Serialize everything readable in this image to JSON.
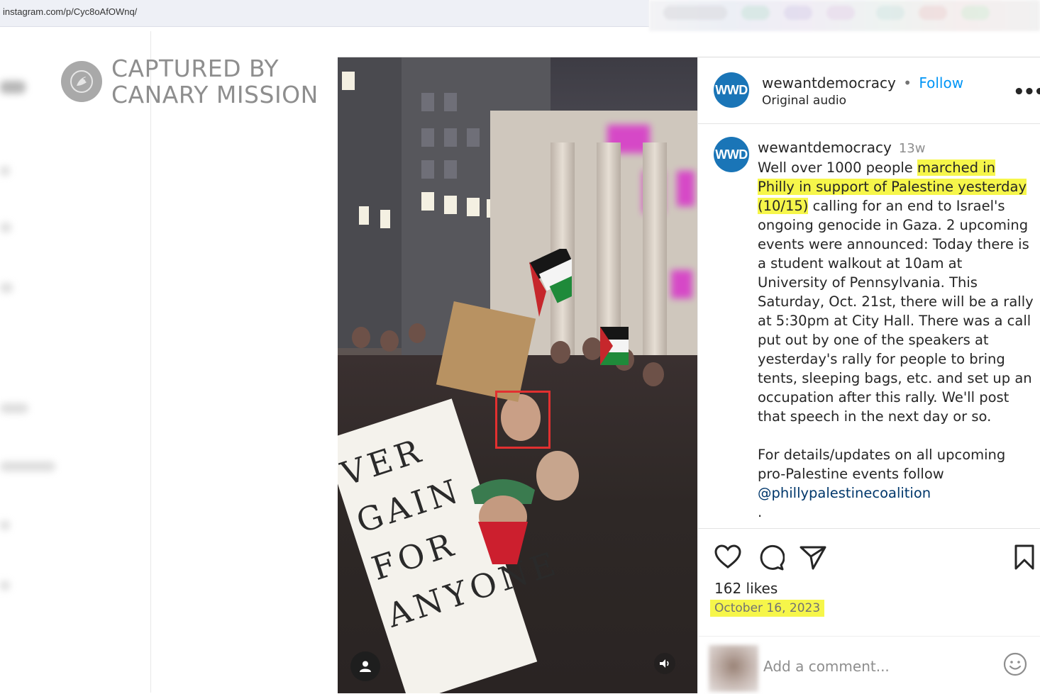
{
  "browser": {
    "url": "instagram.com/p/Cyc8oAfOWnq/"
  },
  "watermark": {
    "line1": "CAPTURED BY",
    "line2": "CANARY MISSION",
    "icon": "canary-bird-icon"
  },
  "media": {
    "sign_text": "VER\nGAIN\nFOR\nANYONE",
    "highlight_color": "#e23030",
    "controls": {
      "profile_icon": "user-icon",
      "audio_icon": "speaker-icon"
    }
  },
  "post": {
    "header": {
      "avatar_text": "WWD",
      "username": "wewantdemocracy",
      "separator": "•",
      "follow_label": "Follow",
      "subtitle": "Original audio",
      "more_label": "•••"
    },
    "caption": {
      "avatar_text": "WWD",
      "username": "wewantdemocracy",
      "time_ago": "13w",
      "text_lead": "Well over 1000 people",
      "text_highlight": "marched in Philly in support of Palestine yesterday (10/15)",
      "text_rest": "calling for an end to Israel's ongoing genocide in Gaza. 2 upcoming events were announced: Today there is a student walkout at 10am at University of Pennsylvania. This Saturday, Oct. 21st, there will be a rally at 5:30pm at City Hall. There was a call put out by one of the speakers at yesterday's rally for people to bring tents, sleeping bags, etc. and set up an occupation after this rally. We'll post that speech in the next day or so.",
      "para2": "For details/updates on all upcoming pro-Palestine events follow",
      "mention": "@phillypalestinecoalition",
      "trailing": "."
    },
    "actions": {
      "icons": [
        "heart-icon",
        "comment-icon",
        "share-icon",
        "bookmark-icon"
      ],
      "likes": "162 likes",
      "date": "October 16, 2023"
    },
    "comment": {
      "placeholder": "Add a comment...",
      "emoji_icon": "smiley-icon"
    },
    "colors": {
      "accent": "#0095f6",
      "highlight": "#f6f64a",
      "avatar": "#1a75b7"
    }
  }
}
